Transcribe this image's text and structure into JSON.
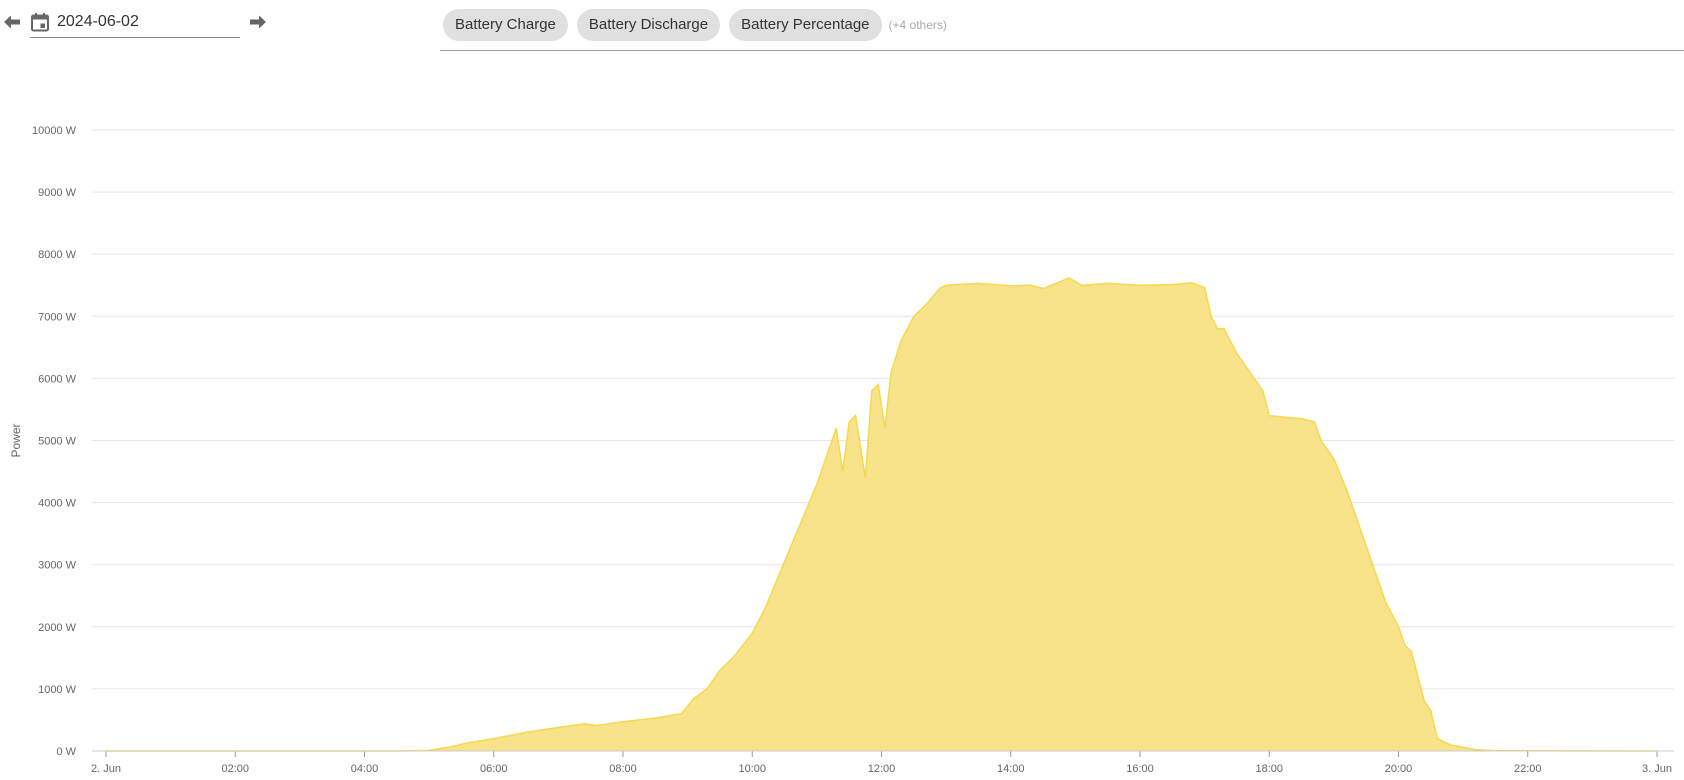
{
  "date_picker": {
    "value": "2024-06-02"
  },
  "icons": {
    "prev": "arrow-left-icon",
    "next": "arrow-right-icon",
    "calendar": "calendar-icon"
  },
  "series_chips": [
    {
      "label": "Battery Charge"
    },
    {
      "label": "Battery Discharge"
    },
    {
      "label": "Battery Percentage"
    }
  ],
  "more_series_label": "(+4 others)",
  "colors": {
    "area_fill": "#f8e38b",
    "area_line": "#f5d94e",
    "grid": "#e6e6e6"
  },
  "chart_data": {
    "type": "area",
    "ylabel": "Power",
    "xlabel": "",
    "ylim": [
      0,
      10000
    ],
    "yticks": [
      0,
      1000,
      2000,
      3000,
      4000,
      5000,
      6000,
      7000,
      8000,
      9000,
      10000
    ],
    "ytick_labels": [
      "0 W",
      "1000 W",
      "2000 W",
      "3000 W",
      "4000 W",
      "5000 W",
      "6000 W",
      "7000 W",
      "8000 W",
      "9000 W",
      "10000 W"
    ],
    "xlim": [
      0,
      24
    ],
    "xticks": [
      0,
      2,
      4,
      6,
      8,
      10,
      12,
      14,
      16,
      18,
      20,
      22,
      24
    ],
    "xtick_labels": [
      "2. Jun",
      "02:00",
      "04:00",
      "06:00",
      "08:00",
      "10:00",
      "12:00",
      "14:00",
      "16:00",
      "18:00",
      "20:00",
      "22:00",
      "3. Jun"
    ],
    "grid": true,
    "series": [
      {
        "x": [
          0,
          4.5,
          5.0,
          5.3,
          5.6,
          6.0,
          6.5,
          7.0,
          7.4,
          7.6,
          8.0,
          8.5,
          8.9,
          9.1,
          9.3,
          9.5,
          9.7,
          10.0,
          10.2,
          10.4,
          10.6,
          10.8,
          11.0,
          11.2,
          11.3,
          11.4,
          11.5,
          11.6,
          11.75,
          11.85,
          11.95,
          12.05,
          12.15,
          12.3,
          12.5,
          12.7,
          12.9,
          13.0,
          13.5,
          14.0,
          14.3,
          14.5,
          14.75,
          14.9,
          15.1,
          15.5,
          16.0,
          16.5,
          16.8,
          17.0,
          17.1,
          17.2,
          17.3,
          17.5,
          17.7,
          17.9,
          18.0,
          18.5,
          18.7,
          18.8,
          19.0,
          19.2,
          19.4,
          19.6,
          19.8,
          20.0,
          20.1,
          20.2,
          20.3,
          20.4,
          20.5,
          20.6,
          20.8,
          21.2,
          21.5,
          24
        ],
        "y": [
          0,
          0,
          10,
          60,
          130,
          200,
          300,
          380,
          440,
          410,
          470,
          530,
          600,
          850,
          1000,
          1300,
          1500,
          1900,
          2300,
          2800,
          3300,
          3800,
          4300,
          4900,
          5200,
          4500,
          5300,
          5400,
          4400,
          5800,
          5900,
          5200,
          6100,
          6600,
          7000,
          7200,
          7450,
          7500,
          7530,
          7490,
          7500,
          7450,
          7550,
          7620,
          7500,
          7530,
          7500,
          7510,
          7540,
          7460,
          7000,
          6800,
          6800,
          6400,
          6100,
          5800,
          5400,
          5350,
          5300,
          5000,
          4700,
          4200,
          3600,
          3000,
          2400,
          2000,
          1700,
          1600,
          1200,
          800,
          650,
          200,
          100,
          20,
          5,
          0
        ]
      }
    ]
  }
}
